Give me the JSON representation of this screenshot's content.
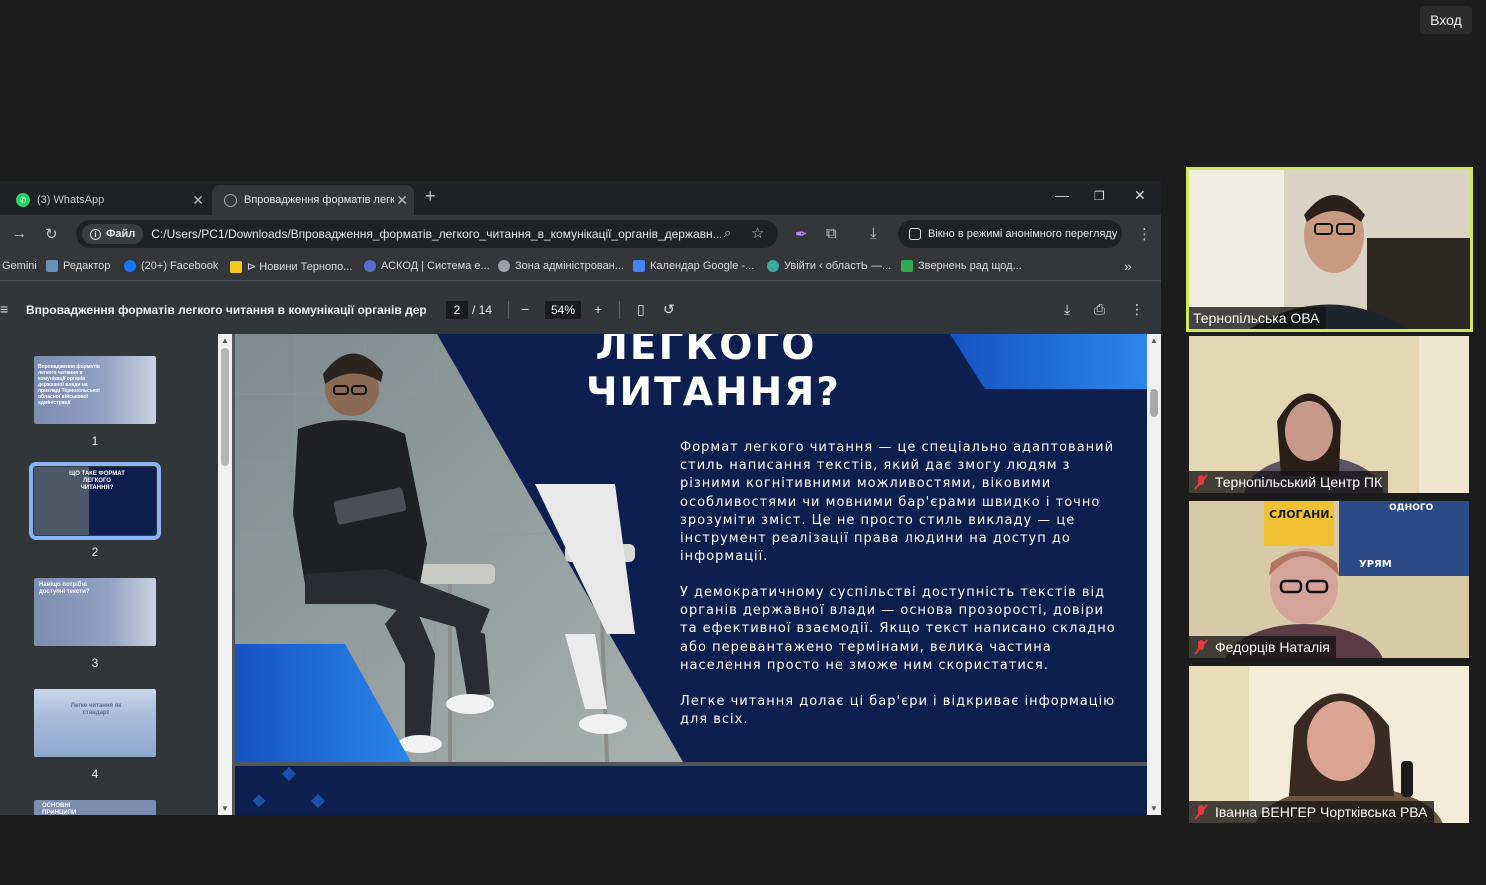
{
  "meeting": {
    "login_label": "Вход"
  },
  "browser": {
    "tabs": [
      {
        "title": "(3) WhatsApp"
      },
      {
        "title": "Впровадження форматів легкого"
      }
    ],
    "address": {
      "file_chip": "Файл",
      "url": "C:/Users/PC1/Downloads/Впровадження_форматів_легкого_читання_в_комунікації_органів_державн..."
    },
    "incognito_label": "Вікно в режимі анонімного перегляду",
    "bookmarks": [
      {
        "label": "Gemini"
      },
      {
        "label": "Редактор"
      },
      {
        "label": "(20+) Facebook"
      },
      {
        "label": "⊳ Новини Тернопо..."
      },
      {
        "label": "АСКОД | Система е..."
      },
      {
        "label": "Зона адміністрован..."
      },
      {
        "label": "Календар Google -..."
      },
      {
        "label": "Увійти ‹ областЬ —..."
      },
      {
        "label": "Звернень рад щод..."
      }
    ]
  },
  "pdf": {
    "title": "Впровадження форматів легкого читання в комунікації органів дер...",
    "current_page": "2",
    "total_pages": "/ 14",
    "zoom": "54%",
    "thumbnails": [
      {
        "number": "1",
        "text": "Впровадження форматів легкого читання в комунікації органів державної влади на прикладі Тернопільської обласної військової адміністрації"
      },
      {
        "number": "2",
        "text": "ЩО ТАКЕ ФОРМАТ ЛЕГКОГО ЧИТАННЯ?"
      },
      {
        "number": "3",
        "text": "Навіщо потрібні доступні тексти?"
      },
      {
        "number": "4",
        "text": "Легке читання як стандарт"
      },
      {
        "number": "5",
        "text": "ОСНОВНІ ПРИНЦИПИ"
      }
    ],
    "slide": {
      "heading_line1": "ЛЕГКОГО",
      "heading_line2": "ЧИТАННЯ?",
      "paragraph1": "Формат легкого читання — це спеціально адаптований стиль написання текстів, який дає змогу людям з різними когнітивними можливостями, віковими особливостями чи мовними бар'єрами швидко і точно зрозуміти зміст. Це не просто стиль викладу — це інструмент реалізації права людини на доступ до інформації.",
      "paragraph2": "У демократичному суспільстві доступність текстів від органів державної влади — основа прозорості, довіри та ефективної взаємодії. Якщо текст написано складно або перевантажено термінами, велика частина населення просто не зможе ним скористатися.",
      "paragraph3": "Легке читання долає ці бар'єри і відкриває інформацію для всіх."
    }
  },
  "participants": [
    {
      "name": "Тернопільська ОВА",
      "muted": false,
      "speaking": true
    },
    {
      "name": "Тернопільський Центр ПК",
      "muted": true,
      "speaking": false
    },
    {
      "name": "Федорців Наталія",
      "muted": true,
      "speaking": false
    },
    {
      "name": "Іванна ВЕНГЕР Чортківська РВА",
      "muted": true,
      "speaking": false
    }
  ],
  "colors": {
    "slide_navy": "#0d1f4f",
    "slide_accent_blue": "#1e6fd9",
    "speaking_border": "#cfe85a",
    "mic_off_red": "#e03b3b"
  }
}
